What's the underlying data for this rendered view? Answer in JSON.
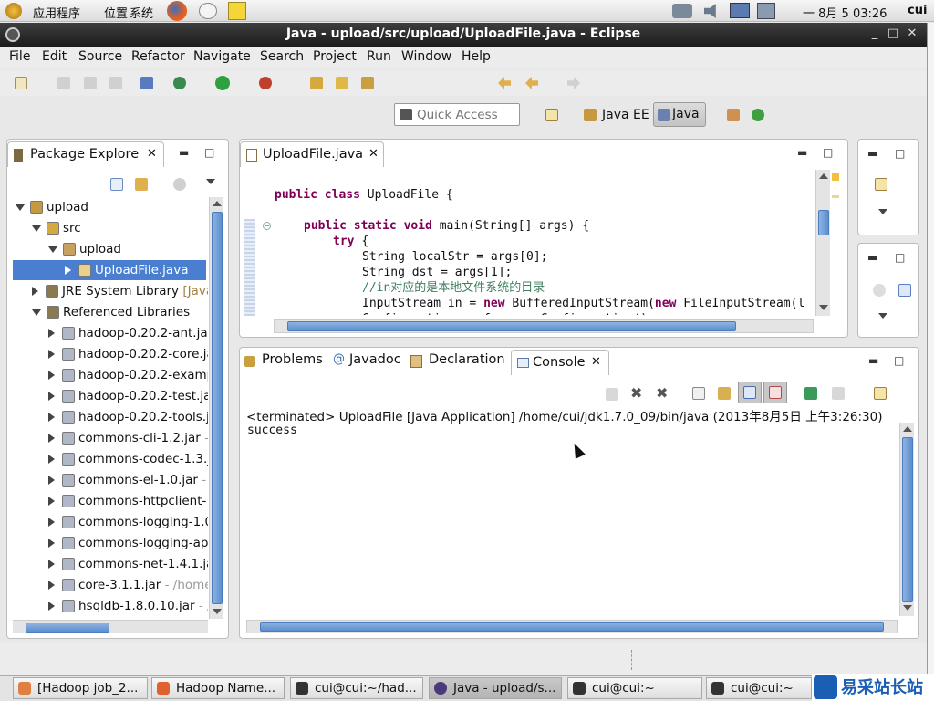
{
  "desktop": {
    "menus": [
      "应用程序",
      "位置",
      "系统"
    ],
    "clock": "一 8月  5 03:26",
    "user": "cui"
  },
  "window": {
    "title": "Java - upload/src/upload/UploadFile.java - Eclipse"
  },
  "menubar": [
    "File",
    "Edit",
    "Source",
    "Refactor",
    "Navigate",
    "Search",
    "Project",
    "Run",
    "Window",
    "Help"
  ],
  "toolbar": {
    "quick_access_placeholder": "Quick Access",
    "perspectives": [
      "Java EE",
      "Java"
    ]
  },
  "package_explorer": {
    "tab": "Package Explore",
    "tree": [
      {
        "label": "upload",
        "suffix": "",
        "level": 0,
        "expanded": true,
        "icon": "project-icon"
      },
      {
        "label": "src",
        "suffix": "",
        "level": 1,
        "expanded": true,
        "icon": "source-folder-icon"
      },
      {
        "label": "upload",
        "suffix": "",
        "level": 2,
        "expanded": true,
        "icon": "package-icon"
      },
      {
        "label": "UploadFile.java",
        "suffix": "",
        "level": 3,
        "expanded": false,
        "selected": true,
        "icon": "java-file-icon"
      },
      {
        "label": "JRE System Library ",
        "suffix": "[Java",
        "level": 1,
        "expanded": false,
        "icon": "library-icon"
      },
      {
        "label": "Referenced Libraries",
        "suffix": "",
        "level": 1,
        "expanded": true,
        "icon": "library-icon"
      },
      {
        "label": "hadoop-0.20.2-ant.jar",
        "suffix": "",
        "level": 2,
        "expanded": false,
        "icon": "jar-icon"
      },
      {
        "label": "hadoop-0.20.2-core.ja",
        "suffix": "",
        "level": 2,
        "expanded": false,
        "icon": "jar-icon"
      },
      {
        "label": "hadoop-0.20.2-examp",
        "suffix": "",
        "level": 2,
        "expanded": false,
        "icon": "jar-icon"
      },
      {
        "label": "hadoop-0.20.2-test.ja",
        "suffix": "",
        "level": 2,
        "expanded": false,
        "icon": "jar-icon"
      },
      {
        "label": "hadoop-0.20.2-tools.j",
        "suffix": "",
        "level": 2,
        "expanded": false,
        "icon": "jar-icon"
      },
      {
        "label": "commons-cli-1.2.jar",
        "suffix": " - ",
        "level": 2,
        "expanded": false,
        "icon": "jar-icon"
      },
      {
        "label": "commons-codec-1.3.j",
        "suffix": "",
        "level": 2,
        "expanded": false,
        "icon": "jar-icon"
      },
      {
        "label": "commons-el-1.0.jar",
        "suffix": " - ",
        "level": 2,
        "expanded": false,
        "icon": "jar-icon"
      },
      {
        "label": "commons-httpclient-",
        "suffix": "",
        "level": 2,
        "expanded": false,
        "icon": "jar-icon"
      },
      {
        "label": "commons-logging-1.0",
        "suffix": "",
        "level": 2,
        "expanded": false,
        "icon": "jar-icon"
      },
      {
        "label": "commons-logging-ap",
        "suffix": "",
        "level": 2,
        "expanded": false,
        "icon": "jar-icon"
      },
      {
        "label": "commons-net-1.4.1.ja",
        "suffix": "",
        "level": 2,
        "expanded": false,
        "icon": "jar-icon"
      },
      {
        "label": "core-3.1.1.jar",
        "suffix": " - /home",
        "level": 2,
        "expanded": false,
        "icon": "jar-icon"
      },
      {
        "label": "hsqldb-1.8.0.10.jar",
        "suffix": " - /",
        "level": 2,
        "expanded": false,
        "icon": "jar-icon"
      }
    ]
  },
  "editor": {
    "tab": "UploadFile.java",
    "lines": [
      {
        "indent": 0,
        "parts": [
          {
            "t": "kw",
            "s": "public class "
          },
          {
            "t": "n",
            "s": "UploadFile {"
          }
        ]
      },
      {
        "indent": 0,
        "parts": []
      },
      {
        "indent": 4,
        "parts": [
          {
            "t": "kw",
            "s": "public static void "
          },
          {
            "t": "n",
            "s": "main(String[] args) {"
          }
        ]
      },
      {
        "indent": 8,
        "parts": [
          {
            "t": "kw",
            "s": "try "
          },
          {
            "t": "n",
            "s": "{"
          }
        ]
      },
      {
        "indent": 12,
        "parts": [
          {
            "t": "n",
            "s": "String localStr = args[0];"
          }
        ]
      },
      {
        "indent": 12,
        "parts": [
          {
            "t": "n",
            "s": "String dst = args[1];"
          }
        ]
      },
      {
        "indent": 12,
        "parts": [
          {
            "t": "cm",
            "s": "//in对应的是本地文件系统的目录"
          }
        ]
      },
      {
        "indent": 12,
        "parts": [
          {
            "t": "n",
            "s": "InputStream in = "
          },
          {
            "t": "kw",
            "s": "new "
          },
          {
            "t": "n",
            "s": "BufferedInputStream("
          },
          {
            "t": "kw",
            "s": "new "
          },
          {
            "t": "n",
            "s": "FileInputStream(l"
          }
        ]
      },
      {
        "indent": 12,
        "parts": [
          {
            "t": "n",
            "s": "Configuration conf = new Configuration();"
          }
        ]
      }
    ]
  },
  "bottom_tabs": [
    "Problems",
    "Javadoc",
    "Declaration",
    "Console"
  ],
  "console": {
    "header": "<terminated> UploadFile [Java Application] /home/cui/jdk1.7.0_09/bin/java (2013年8月5日 上午3:26:30)",
    "output": "success"
  },
  "taskbar": [
    "[Hadoop job_2...",
    "Hadoop Name...",
    "cui@cui:~/had...",
    "Java - upload/s...",
    "cui@cui:~",
    "cui@cui:~"
  ],
  "watermark": "易采站长站",
  "colors": {
    "selection": "#4a7ed0",
    "keyword": "#7f0055",
    "comment": "#3f7f5f"
  }
}
